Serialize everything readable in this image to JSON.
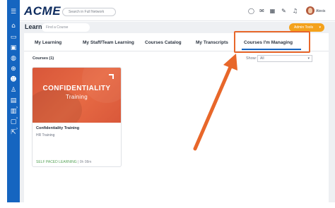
{
  "header": {
    "logo": "ACME",
    "search_placeholder": "Search in Full Network",
    "icons": [
      "chat-icon",
      "mail-icon",
      "grid-icon",
      "edit-icon",
      "bell-icon"
    ],
    "user_name": "Alexis"
  },
  "sidebar": {
    "icons": [
      "home-icon",
      "screen-icon",
      "briefcase-icon",
      "globe-icon",
      "cart-icon",
      "people-icon",
      "person-icon",
      "certificate-icon",
      "learn-icon",
      "building-icon",
      "chat-icon",
      "external-icon"
    ]
  },
  "learn": {
    "title": "Learn",
    "find_placeholder": "Find a Course",
    "admin_tools_label": "Admin Tools",
    "tabs": [
      {
        "label": "My Learning"
      },
      {
        "label": "My Staff/Team Learning"
      },
      {
        "label": "Courses Catalog"
      },
      {
        "label": "My Transcripts"
      },
      {
        "label": "Courses I'm Managing"
      }
    ],
    "active_tab": "Courses I'm Managing",
    "courses_count_label": "Courses (1)",
    "show_label": "Show:",
    "show_value": "All"
  },
  "courses": [
    {
      "thumb_title": "CONFIDENTIALITY",
      "thumb_subtitle": "Training",
      "title": "Confidentiality Training",
      "category": "HR Training",
      "type": "SELF PACED LEARNING",
      "separator": " | ",
      "duration": "0h 08m"
    }
  ],
  "colors": {
    "sidebar": "#1565c0",
    "accent": "#f4a21c",
    "highlight": "#e8672a",
    "course_type": "#58a45a"
  }
}
